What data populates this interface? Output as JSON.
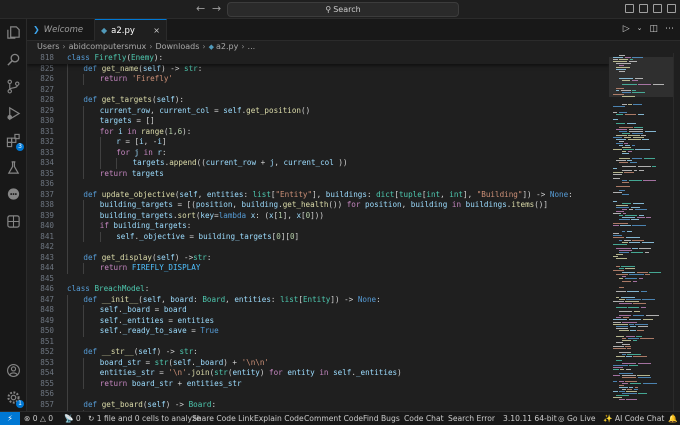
{
  "titlebar": {
    "back_icon": "arrow-left-icon",
    "forward_icon": "arrow-right-icon",
    "search_label": "Search"
  },
  "tabs": [
    {
      "label": "Welcome",
      "icon": "vscode-logo-icon",
      "active": false
    },
    {
      "label": "a2.py",
      "icon": "python-file-icon",
      "active": true,
      "close": "×"
    }
  ],
  "breadcrumb": [
    "Users",
    "abidcomputersmux",
    "Downloads",
    "a2.py",
    "..."
  ],
  "sticky": {
    "ln": "818",
    "indent": 0,
    "code": "<span class=\"kw\">class</span> <span class=\"cls\">Firefly</span>(<span class=\"cls\">Enemy</span>):"
  },
  "code_lines": [
    {
      "ln": "825",
      "indent": 1,
      "code": "<span class=\"kw\">def</span> <span class=\"fn\">get_name</span>(<span class=\"var\">self</span>) -> <span class=\"cls\">str</span>:"
    },
    {
      "ln": "826",
      "indent": 2,
      "code": "<span class=\"ctl\">return</span> <span class=\"str\">'Firefly'</span>"
    },
    {
      "ln": "827",
      "indent": 1,
      "code": ""
    },
    {
      "ln": "828",
      "indent": 1,
      "code": "<span class=\"kw\">def</span> <span class=\"fn\">get_targets</span>(<span class=\"var\">self</span>):"
    },
    {
      "ln": "829",
      "indent": 2,
      "code": "<span class=\"var\">current_row</span>, <span class=\"var\">current_col</span> = <span class=\"var\">self</span>.<span class=\"fn\">get_position</span>()"
    },
    {
      "ln": "830",
      "indent": 2,
      "code": "<span class=\"var\">targets</span> = []"
    },
    {
      "ln": "831",
      "indent": 2,
      "code": "<span class=\"ctl\">for</span> <span class=\"var\">i</span> <span class=\"ctl\">in</span> <span class=\"fn\">range</span>(<span class=\"num\">1</span>,<span class=\"num\">6</span>):"
    },
    {
      "ln": "832",
      "indent": 3,
      "code": "<span class=\"var\">r</span> = [<span class=\"var\">i</span>, -<span class=\"var\">i</span>]"
    },
    {
      "ln": "833",
      "indent": 3,
      "code": "<span class=\"ctl\">for</span> <span class=\"var\">j</span> <span class=\"ctl\">in</span> <span class=\"var\">r</span>:"
    },
    {
      "ln": "834",
      "indent": 4,
      "code": "<span class=\"var\">targets</span>.<span class=\"fn\">append</span>((<span class=\"var\">current_row</span> + <span class=\"var\">j</span>, <span class=\"var\">current_col</span> ))"
    },
    {
      "ln": "835",
      "indent": 2,
      "code": "<span class=\"ctl\">return</span> <span class=\"var\">targets</span>"
    },
    {
      "ln": "836",
      "indent": 1,
      "code": ""
    },
    {
      "ln": "837",
      "indent": 1,
      "code": "<span class=\"kw\">def</span> <span class=\"fn\">update_objective</span>(<span class=\"var\">self</span>, <span class=\"var\">entities</span>: <span class=\"cls\">list</span>[<span class=\"str\">\"Entity\"</span>], <span class=\"var\">buildings</span>: <span class=\"cls\">dict</span>[<span class=\"cls\">tuple</span>[<span class=\"cls\">int</span>, <span class=\"cls\">int</span>], <span class=\"str\">\"Building\"</span>]) -> <span class=\"kw\">None</span>:"
    },
    {
      "ln": "838",
      "indent": 2,
      "code": "<span class=\"var\">building_targets</span> = [(<span class=\"var\">position</span>, <span class=\"var\">building</span>.<span class=\"fn\">get_health</span>()) <span class=\"ctl\">for</span> <span class=\"var\">position</span>, <span class=\"var\">building</span> <span class=\"ctl\">in</span> <span class=\"var\">buildings</span>.<span class=\"fn\">items</span>()]"
    },
    {
      "ln": "839",
      "indent": 2,
      "code": "<span class=\"var\">building_targets</span>.<span class=\"fn\">sort</span>(<span class=\"var\">key</span>=<span class=\"kw\">lambda</span> <span class=\"var\">x</span>: (<span class=\"var\">x</span>[<span class=\"num\">1</span>], <span class=\"var\">x</span>[<span class=\"num\">0</span>]))"
    },
    {
      "ln": "840",
      "indent": 2,
      "code": "<span class=\"ctl\">if</span> <span class=\"var\">building_targets</span>:"
    },
    {
      "ln": "841",
      "indent": 3,
      "code": "<span class=\"var\">self</span>.<span class=\"var\">_objective</span> = <span class=\"var\">building_targets</span>[<span class=\"num\">0</span>][<span class=\"num\">0</span>]"
    },
    {
      "ln": "842",
      "indent": 1,
      "code": ""
    },
    {
      "ln": "843",
      "indent": 1,
      "code": "<span class=\"kw\">def</span> <span class=\"fn\">get_display</span>(<span class=\"var\">self</span>) -><span class=\"cls\">str</span>:"
    },
    {
      "ln": "844",
      "indent": 2,
      "code": "<span class=\"ctl\">return</span> <span class=\"cst\">FIREFLY_DISPLAY</span>"
    },
    {
      "ln": "845",
      "indent": 0,
      "code": ""
    },
    {
      "ln": "846",
      "indent": 0,
      "code": "<span class=\"kw\">class</span> <span class=\"cls\">BreachModel</span>:"
    },
    {
      "ln": "847",
      "indent": 1,
      "code": "<span class=\"kw\">def</span> <span class=\"fn\">__init__</span>(<span class=\"var\">self</span>, <span class=\"var\">board</span>: <span class=\"cls\">Board</span>, <span class=\"var\">entities</span>: <span class=\"cls\">list</span>[<span class=\"cls\">Entity</span>]) -> <span class=\"kw\">None</span>:"
    },
    {
      "ln": "848",
      "indent": 2,
      "code": "<span class=\"var\">self</span>.<span class=\"var\">_board</span> = <span class=\"var\">board</span>"
    },
    {
      "ln": "849",
      "indent": 2,
      "code": "<span class=\"var\">self</span>.<span class=\"var\">_entities</span> = <span class=\"var\">entities</span>"
    },
    {
      "ln": "850",
      "indent": 2,
      "code": "<span class=\"var\">self</span>.<span class=\"var\">_ready_to_save</span> = <span class=\"kw\">True</span>"
    },
    {
      "ln": "851",
      "indent": 1,
      "code": ""
    },
    {
      "ln": "852",
      "indent": 1,
      "code": "<span class=\"kw\">def</span> <span class=\"fn\">__str__</span>(<span class=\"var\">self</span>) -> <span class=\"cls\">str</span>:"
    },
    {
      "ln": "853",
      "indent": 2,
      "code": "<span class=\"var\">board_str</span> = <span class=\"cls\">str</span>(<span class=\"var\">self</span>.<span class=\"var\">_board</span>) + <span class=\"str\">'\\n\\n'</span>"
    },
    {
      "ln": "854",
      "indent": 2,
      "code": "<span class=\"var\">entities_str</span> = <span class=\"str\">'\\n'</span>.<span class=\"fn\">join</span>(<span class=\"cls\">str</span>(<span class=\"var\">entity</span>) <span class=\"ctl\">for</span> <span class=\"var\">entity</span> <span class=\"ctl\">in</span> <span class=\"var\">self</span>.<span class=\"var\">_entities</span>)"
    },
    {
      "ln": "855",
      "indent": 2,
      "code": "<span class=\"ctl\">return</span> <span class=\"var\">board_str</span> + <span class=\"var\">entities_str</span>"
    },
    {
      "ln": "856",
      "indent": 1,
      "code": ""
    },
    {
      "ln": "857",
      "indent": 1,
      "code": "<span class=\"kw\">def</span> <span class=\"fn\">get_board</span>(<span class=\"var\">self</span>) -> <span class=\"cls\">Board</span>:"
    },
    {
      "ln": "858",
      "indent": 2,
      "code": "<span class=\"ctl\">return</span> <span class=\"var\">self</span>.<span class=\"var\">_board</span>"
    },
    {
      "ln": "859",
      "indent": 1,
      "code": ""
    }
  ],
  "activity": [
    {
      "name": "explorer-icon"
    },
    {
      "name": "search-icon"
    },
    {
      "name": "source-control-icon"
    },
    {
      "name": "run-debug-icon"
    },
    {
      "name": "extensions-icon",
      "badge": "3"
    },
    {
      "name": "testing-icon"
    },
    {
      "name": "chat-icon"
    },
    {
      "name": "remote-explorer-icon"
    }
  ],
  "activity_bottom": [
    {
      "name": "account-icon"
    },
    {
      "name": "manage-gear-icon",
      "badge": "1"
    }
  ],
  "statusbar": {
    "remote_glyph": "⚡",
    "errors": "0",
    "warnings": "0",
    "ports": "0",
    "analyze": "1 file and 0 cells to analyze",
    "share": "Share Code Link",
    "explain": "Explain Code",
    "comment": "Comment Code",
    "bugs": "Find Bugs",
    "code_chat": "Code Chat",
    "search_error": "Search Error",
    "python": "3.10.11 64-bit",
    "golive": "Go Live",
    "ai_chat": "AI Code Chat"
  },
  "colors": {
    "accent": "#0078d4",
    "editor_bg": "#1f1f1f"
  }
}
